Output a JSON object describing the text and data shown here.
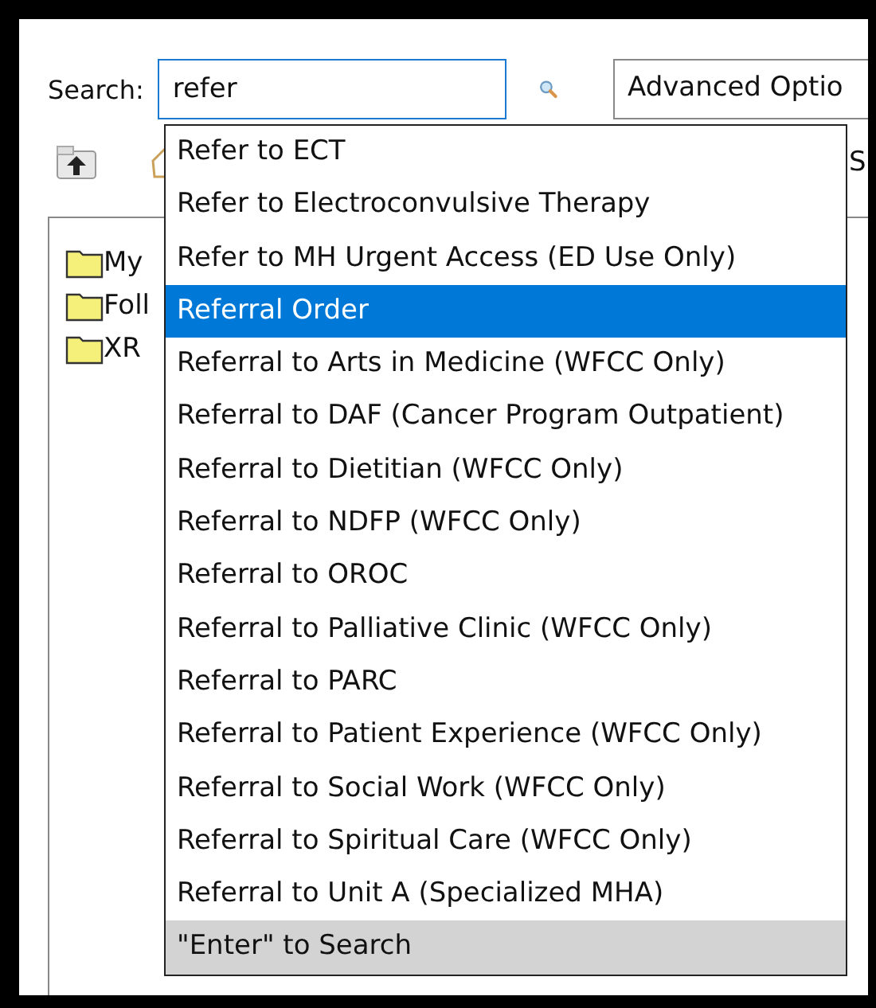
{
  "search": {
    "label": "Search:",
    "value": "refer",
    "options_label": "Advanced Optio"
  },
  "toolbar": {
    "label": "S"
  },
  "tree": {
    "items": [
      {
        "label": "My"
      },
      {
        "label": "Foll"
      },
      {
        "label": "XR"
      }
    ]
  },
  "suggestions": {
    "items": [
      {
        "label": "Refer to ECT",
        "selected": false
      },
      {
        "label": "Refer to Electroconvulsive Therapy",
        "selected": false
      },
      {
        "label": "Refer to MH Urgent Access (ED Use Only)",
        "selected": false
      },
      {
        "label": "Referral Order",
        "selected": true
      },
      {
        "label": "Referral to Arts in Medicine (WFCC Only)",
        "selected": false
      },
      {
        "label": "Referral to DAF (Cancer Program Outpatient)",
        "selected": false
      },
      {
        "label": "Referral to Dietitian (WFCC Only)",
        "selected": false
      },
      {
        "label": "Referral to NDFP (WFCC Only)",
        "selected": false
      },
      {
        "label": "Referral to OROC",
        "selected": false
      },
      {
        "label": "Referral to Palliative Clinic (WFCC Only)",
        "selected": false
      },
      {
        "label": "Referral to PARC",
        "selected": false
      },
      {
        "label": "Referral to Patient Experience (WFCC Only)",
        "selected": false
      },
      {
        "label": "Referral to Social Work (WFCC Only)",
        "selected": false
      },
      {
        "label": "Referral to Spiritual Care (WFCC Only)",
        "selected": false
      },
      {
        "label": "Referral to Unit A (Specialized MHA)",
        "selected": false
      }
    ],
    "footer": "\"Enter\" to Search"
  }
}
